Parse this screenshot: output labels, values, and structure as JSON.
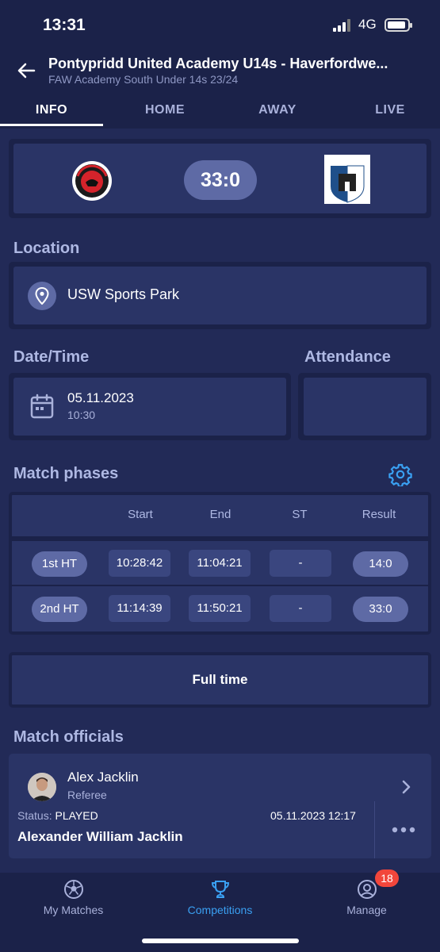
{
  "status_bar": {
    "time": "13:31",
    "network": "4G"
  },
  "header": {
    "title": "Pontypridd United Academy U14s - Haverfordwe...",
    "subtitle": "FAW Academy South Under 14s 23/24"
  },
  "tabs": [
    {
      "label": "INFO"
    },
    {
      "label": "HOME"
    },
    {
      "label": "AWAY"
    },
    {
      "label": "LIVE"
    }
  ],
  "score": {
    "value": "33:0",
    "home_crest": "pontypridd-united-crest",
    "away_crest": "haverfordwest-county-crest"
  },
  "location": {
    "label": "Location",
    "venue": "USW Sports Park"
  },
  "datetime": {
    "label": "Date/Time",
    "date": "05.11.2023",
    "time": "10:30"
  },
  "attendance": {
    "label": "Attendance",
    "value": ""
  },
  "match_phases": {
    "label": "Match phases",
    "columns": [
      "Start",
      "End",
      "ST",
      "Result"
    ],
    "rows": [
      {
        "phase": "1st HT",
        "start": "10:28:42",
        "end": "11:04:21",
        "st": "-",
        "result": "14:0"
      },
      {
        "phase": "2nd HT",
        "start": "11:14:39",
        "end": "11:50:21",
        "st": "-",
        "result": "33:0"
      }
    ]
  },
  "full_time_button": "Full time",
  "officials": {
    "label": "Match officials",
    "items": [
      {
        "name": "Alex Jacklin",
        "role": "Referee"
      }
    ]
  },
  "status_panel": {
    "status_prefix": "Status:",
    "status_value": "PLAYED",
    "timestamp": "05.11.2023 12:17",
    "user": "Alexander William Jacklin"
  },
  "bottom_nav": {
    "items": [
      {
        "label": "My Matches",
        "icon": "football-icon"
      },
      {
        "label": "Competitions",
        "icon": "trophy-icon"
      },
      {
        "label": "Manage",
        "icon": "user-circle-icon"
      }
    ],
    "badge": "18"
  },
  "colors": {
    "background": "#1b2249",
    "panel": "#2a3466",
    "pill": "#5e6aa5",
    "active_nav": "#3aa0f2",
    "badge": "#f2463b"
  }
}
